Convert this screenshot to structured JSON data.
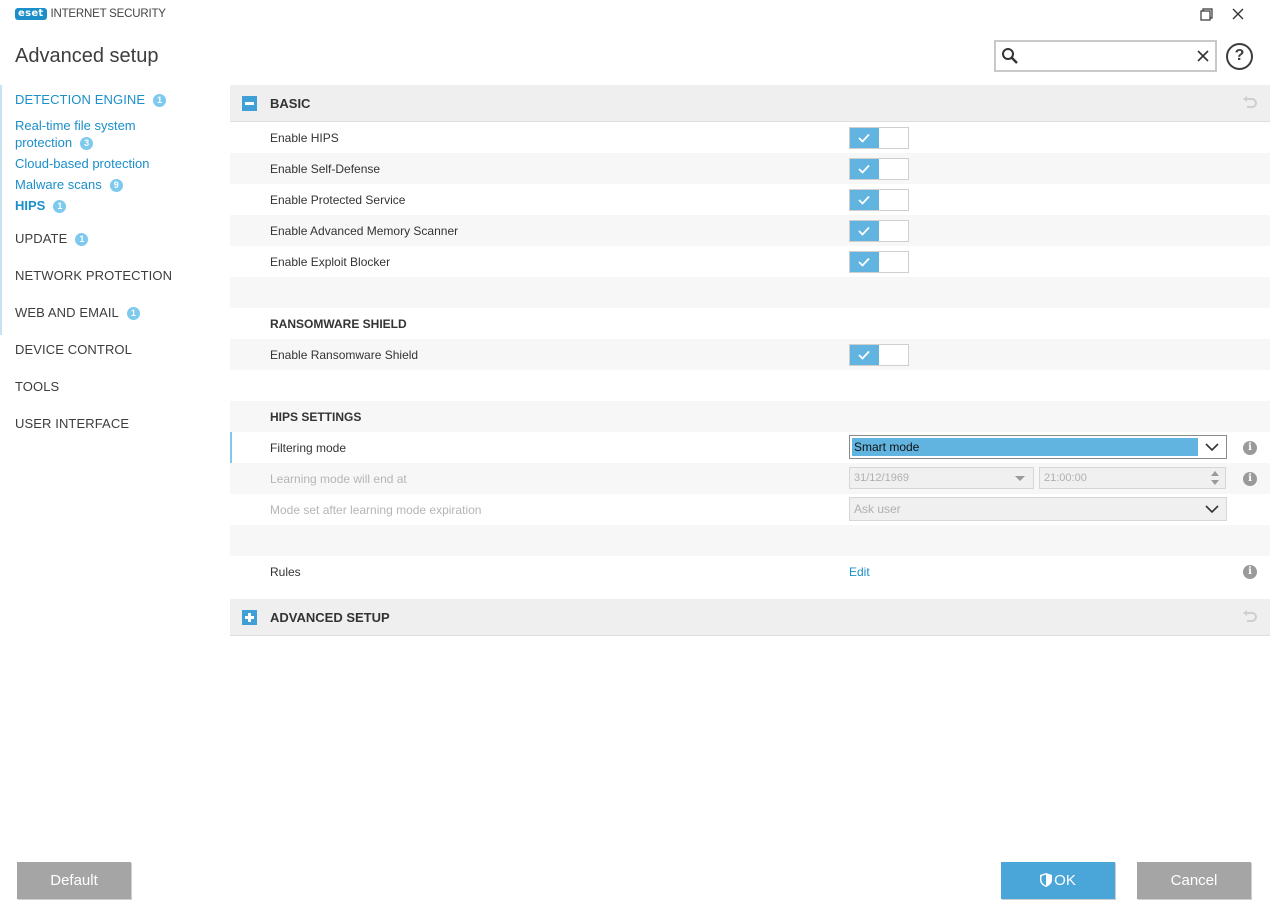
{
  "window": {
    "brand_logo": "eset",
    "product_name": "INTERNET SECURITY",
    "restore_icon": "restore-window-icon",
    "close_icon": "close-icon"
  },
  "page_title": "Advanced setup",
  "search": {
    "value": "",
    "placeholder": "",
    "icon": "search-icon",
    "clear_icon": "clear-icon"
  },
  "help": {
    "label": "?"
  },
  "sidebar": {
    "items": [
      {
        "label": "DETECTION ENGINE",
        "badge": "1",
        "active": true,
        "children": [
          {
            "label_line1": "Real-time file system",
            "label_line2": "protection",
            "badge": "3"
          },
          {
            "label": "Cloud-based protection"
          },
          {
            "label": "Malware scans",
            "badge": "9"
          },
          {
            "label": "HIPS",
            "badge": "1",
            "current": true
          }
        ]
      },
      {
        "label": "UPDATE",
        "badge": "1"
      },
      {
        "label": "NETWORK PROTECTION"
      },
      {
        "label": "WEB AND EMAIL",
        "badge": "1"
      },
      {
        "label": "DEVICE CONTROL"
      },
      {
        "label": "TOOLS"
      },
      {
        "label": "USER INTERFACE"
      }
    ]
  },
  "basic": {
    "title": "BASIC",
    "expanded": true,
    "toggles": [
      {
        "label": "Enable HIPS",
        "on": true
      },
      {
        "label": "Enable Self-Defense",
        "on": true
      },
      {
        "label": "Enable Protected Service",
        "on": true
      },
      {
        "label": "Enable Advanced Memory Scanner",
        "on": true
      },
      {
        "label": "Enable Exploit Blocker",
        "on": true
      }
    ],
    "ransomware": {
      "title": "RANSOMWARE SHIELD",
      "toggle_label": "Enable Ransomware Shield",
      "on": true
    },
    "hips_settings": {
      "title": "HIPS SETTINGS",
      "filtering_mode_label": "Filtering mode",
      "filtering_mode_value": "Smart mode",
      "learning_end_label": "Learning mode will end at",
      "learning_end_date": "31/12/1969",
      "learning_end_time": "21:00:00",
      "mode_after_label": "Mode set after learning mode expiration",
      "mode_after_value": "Ask user",
      "rules_label": "Rules",
      "rules_action": "Edit"
    }
  },
  "advanced": {
    "title": "ADVANCED SETUP",
    "expanded": false
  },
  "info_icon": "i",
  "colors": {
    "accent": "#1a8fc9",
    "toggle_on": "#62b4e0",
    "badge": "#7ec9ee",
    "ok_button": "#4aa6d9",
    "neutral_button": "#a5a5a5"
  },
  "footer": {
    "default_label": "Default",
    "ok_label": "OK",
    "cancel_label": "Cancel"
  }
}
